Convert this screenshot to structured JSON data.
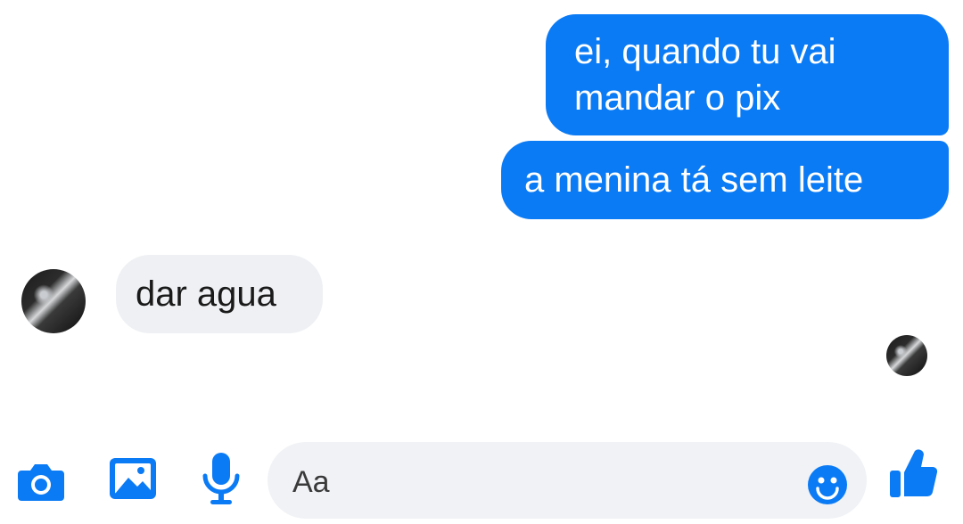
{
  "conversation": {
    "messages": [
      {
        "direction": "outgoing",
        "text": "ei, quando tu vai\nmandar o pix"
      },
      {
        "direction": "outgoing",
        "text": "a menina tá sem leite"
      },
      {
        "direction": "incoming",
        "text": "dar agua"
      }
    ]
  },
  "composer": {
    "placeholder": "Aa",
    "icons": [
      "camera-icon",
      "image-icon",
      "microphone-icon",
      "emoji-icon",
      "thumbs-up-icon"
    ]
  },
  "colors": {
    "accent": "#0b7bf5",
    "incoming_bubble": "#eef0f3",
    "input_background": "#f0f2f5"
  }
}
